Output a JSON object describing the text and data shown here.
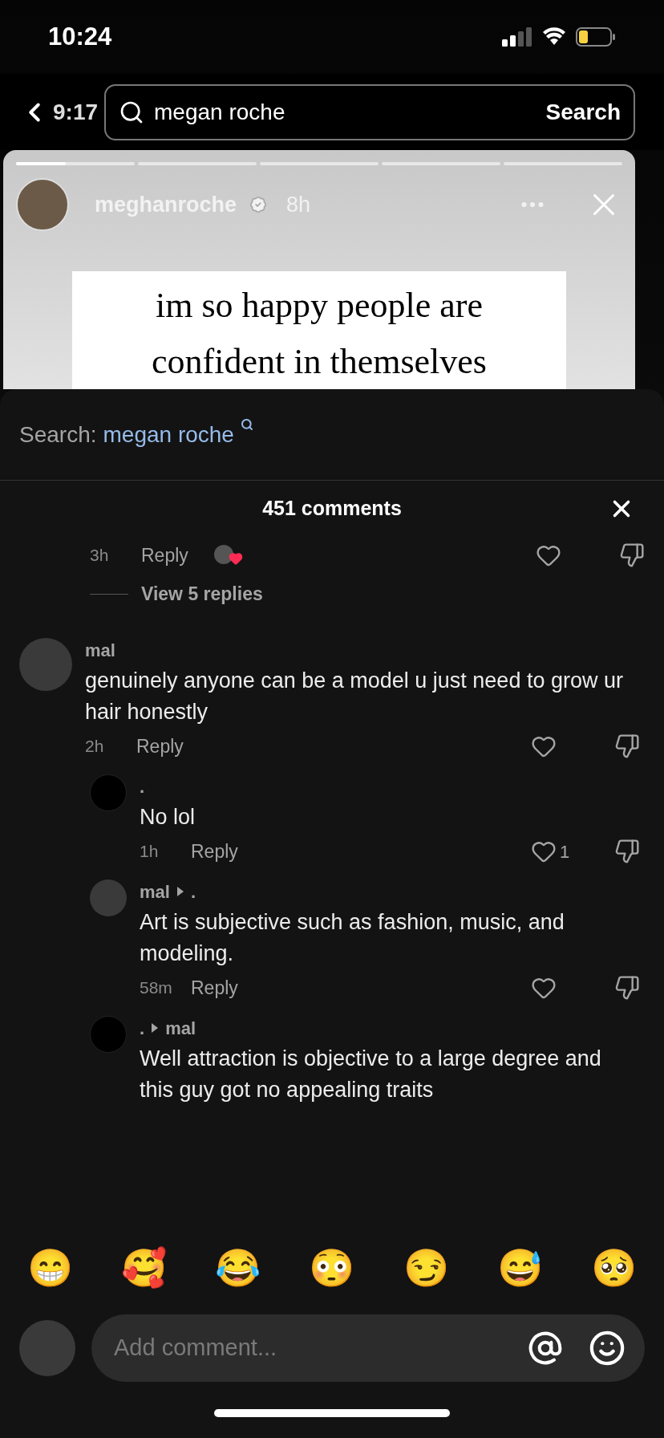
{
  "status_bar": {
    "time": "10:24"
  },
  "top_bar": {
    "back_label": "9:17",
    "search_value": "megan roche",
    "search_button": "Search"
  },
  "story": {
    "segments": [
      {
        "level": 0.42
      },
      {
        "level": 0
      },
      {
        "level": 0
      },
      {
        "level": 0
      },
      {
        "level": 0
      }
    ],
    "username": "meghanroche",
    "verified": true,
    "time": "8h",
    "caption_lines": [
      "im so happy people are",
      "confident in themselves"
    ]
  },
  "comments_sheet": {
    "search_label": "Search:",
    "search_query": "megan roche",
    "title": "451 comments",
    "comments": [
      {
        "kind": "partial",
        "time": "3h",
        "reply_label": "Reply",
        "creator_liked": true
      },
      {
        "kind": "view_replies",
        "label": "View 5 replies"
      },
      {
        "kind": "comment",
        "avatar_photo": true,
        "username": "mal",
        "text": "genuinely anyone can be a model u just need to grow ur hair honestly",
        "time": "2h",
        "reply_label": "Reply"
      },
      {
        "kind": "reply",
        "avatar_photo": false,
        "username": ".",
        "text": "No lol",
        "time": "1h",
        "reply_label": "Reply",
        "likes": "1"
      },
      {
        "kind": "reply",
        "avatar_photo": true,
        "username": "mal",
        "reply_to": ".",
        "text": "Art is subjective such as fashion, music, and modeling.",
        "time": "58m",
        "reply_label": "Reply"
      },
      {
        "kind": "reply",
        "avatar_photo": false,
        "username": ".",
        "reply_to": "mal",
        "text": "Well attraction is objective to a large degree and this guy got no appealing traits"
      }
    ]
  },
  "emoji_bar": [
    "😁",
    "🥰",
    "😂",
    "😳",
    "😏",
    "😅",
    "🥺"
  ],
  "composer": {
    "placeholder": "Add comment..."
  }
}
